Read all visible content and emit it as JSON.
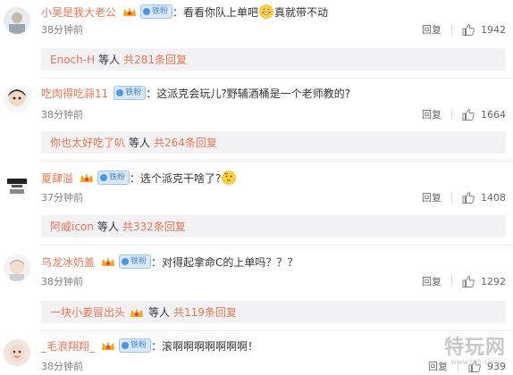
{
  "comments": [
    {
      "username": "小吴是我大老公",
      "fan_badge": "铁粉",
      "text_before": "：看看你队上单吧",
      "text_after": "真就带不动",
      "emoji": "grin-face",
      "time": "38分钟前",
      "reply_label": "回复",
      "likes": "1942",
      "thread": {
        "user": "Enoch-H",
        "mid": "等人",
        "count": "共281条回复"
      }
    },
    {
      "username": "吃肉得吃蒜11",
      "fan_badge": "铁粉",
      "text_before": "：这派克会玩儿?野辅酒桶是一个老师教的?",
      "text_after": "",
      "emoji": "",
      "time": "38分钟前",
      "reply_label": "回复",
      "likes": "1664",
      "thread": {
        "user": "你也太好吃了叭",
        "mid": "等人",
        "count": "共264条回复"
      }
    },
    {
      "username": "夏肆溢",
      "fan_badge": "铁粉",
      "text_before": "：选个派克干啥了?",
      "text_after": "",
      "emoji": "thinking-face",
      "time": "37分钟前",
      "reply_label": "回复",
      "likes": "1408",
      "thread": {
        "user": "阿威icon",
        "mid": "等人",
        "count": "共332条回复"
      }
    },
    {
      "username": "乌龙冰奶盖",
      "fan_badge": "铁粉",
      "text_before": "：对得起拿命C的上单吗？？？",
      "text_after": "",
      "emoji": "",
      "time": "38分钟前",
      "reply_label": "回复",
      "likes": "1292",
      "thread": {
        "user": "一块小姜冒出头",
        "mid": "等人",
        "count": "共119条回复"
      }
    },
    {
      "username": "_毛浪翔翔_",
      "fan_badge": "铁粉",
      "text_before": "：滚啊啊啊啊啊啊啊！",
      "text_after": "",
      "emoji": "",
      "time": "38分钟前",
      "reply_label": "回复",
      "likes": "939",
      "thread": null
    }
  ],
  "watermark": {
    "main": "特玩网",
    "sub": "www.te5.com"
  },
  "colors": {
    "username": "#eb7350",
    "badge_bg": "#d9e9fb",
    "badge_text": "#3f84d8",
    "reply_box": "#f2f2f5"
  }
}
